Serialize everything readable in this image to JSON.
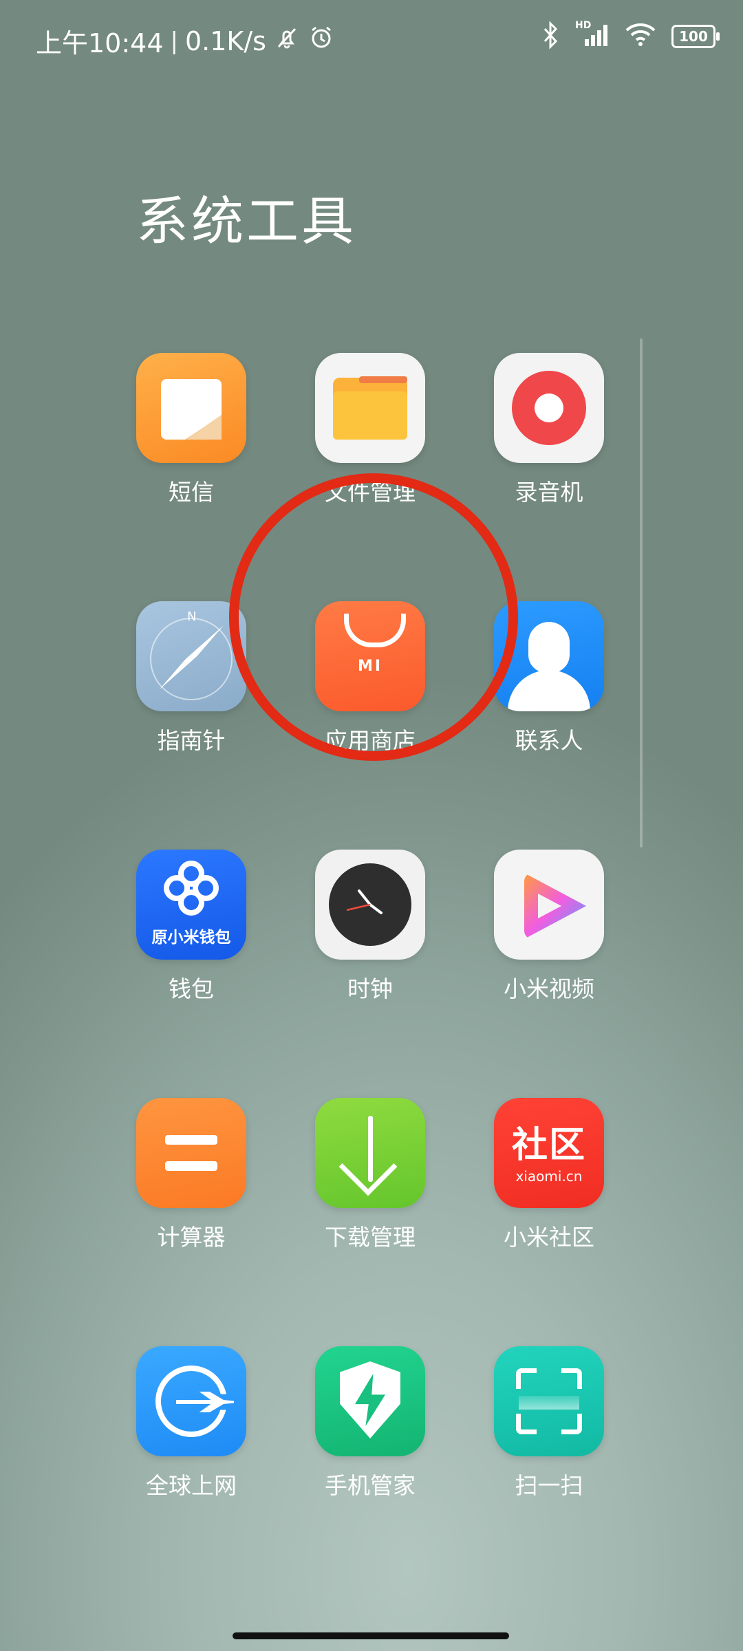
{
  "status_bar": {
    "time": "上午10:44",
    "separator": "|",
    "net_speed": "0.1K/s",
    "icons": [
      "mute-icon",
      "alarm-icon",
      "bluetooth-icon",
      "hd-signal-icon",
      "wifi-icon",
      "battery-icon"
    ],
    "signal_label": "HD",
    "battery_level": "100"
  },
  "folder": {
    "title": "系统工具"
  },
  "apps": [
    {
      "label": "短信",
      "icon": "sms-icon"
    },
    {
      "label": "文件管理",
      "icon": "file-manager-icon"
    },
    {
      "label": "录音机",
      "icon": "recorder-icon"
    },
    {
      "label": "指南针",
      "icon": "compass-icon"
    },
    {
      "label": "应用商店",
      "icon": "app-store-icon",
      "icon_text": "MI"
    },
    {
      "label": "联系人",
      "icon": "contacts-icon"
    },
    {
      "label": "钱包",
      "icon": "wallet-icon",
      "icon_text": "原小米钱包"
    },
    {
      "label": "时钟",
      "icon": "clock-icon"
    },
    {
      "label": "小米视频",
      "icon": "video-icon"
    },
    {
      "label": "计算器",
      "icon": "calculator-icon"
    },
    {
      "label": "下载管理",
      "icon": "download-icon"
    },
    {
      "label": "小米社区",
      "icon": "community-icon",
      "icon_text": "社区",
      "icon_subtext": "xiaomi.cn"
    },
    {
      "label": "全球上网",
      "icon": "global-internet-icon"
    },
    {
      "label": "手机管家",
      "icon": "security-icon"
    },
    {
      "label": "扫一扫",
      "icon": "scanner-icon"
    }
  ],
  "colors": {
    "highlight_ring": "#e22a14"
  }
}
